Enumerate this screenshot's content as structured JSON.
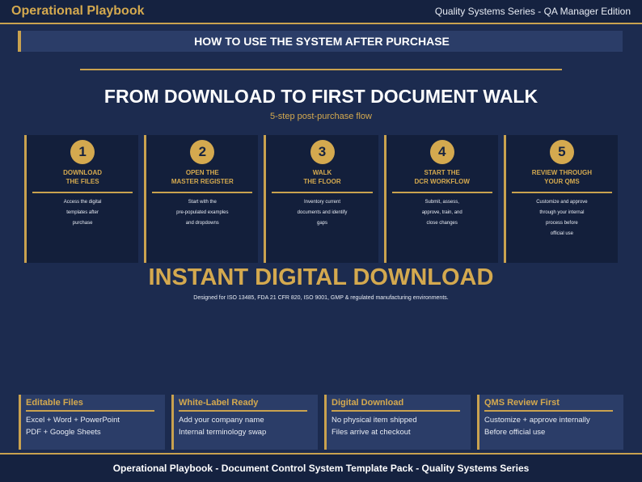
{
  "header": {
    "brand": "Operational Playbook",
    "edition": "Quality Systems Series - QA Manager Edition"
  },
  "banner": {
    "text": "HOW TO USE THE SYSTEM AFTER PURCHASE"
  },
  "hero": {
    "title": "FROM DOWNLOAD TO FIRST DOCUMENT WALK",
    "subtitle": "5-step post-purchase flow"
  },
  "steps": [
    {
      "num": "1",
      "title": "DOWNLOAD\nTHE FILES",
      "desc": "Access the digital\ntemplates after\npurchase"
    },
    {
      "num": "2",
      "title": "OPEN THE\nMASTER REGISTER",
      "desc": "Start with the\npre-populated examples\nand dropdowns"
    },
    {
      "num": "3",
      "title": "WALK\nTHE FLOOR",
      "desc": "Inventory current\ndocuments and identify\ngaps"
    },
    {
      "num": "4",
      "title": "START THE\nDCR WORKFLOW",
      "desc": "Submit, assess,\napprove, train, and\nclose changes"
    },
    {
      "num": "5",
      "title": "REVIEW THROUGH\nYOUR QMS",
      "desc": "Customize and approve\nthrough your internal\nprocess before\nofficial use"
    }
  ],
  "download": {
    "title": "INSTANT DIGITAL DOWNLOAD",
    "note": "Designed for ISO 13485, FDA 21 CFR 820, ISO 9001, GMP & regulated manufacturing environments."
  },
  "features": [
    {
      "title": "Editable Files",
      "line1": "Excel + Word + PowerPoint",
      "line2": "PDF + Google Sheets"
    },
    {
      "title": "White-Label Ready",
      "line1": "Add your company name",
      "line2": "Internal terminology swap"
    },
    {
      "title": "Digital Download",
      "line1": "No physical item shipped",
      "line2": "Files arrive at checkout"
    },
    {
      "title": "QMS Review First",
      "line1": "Customize + approve internally",
      "line2": "Before official use"
    }
  ],
  "footer": {
    "text": "Operational Playbook  -  Document Control System Template Pack  -  Quality Systems Series"
  },
  "colors": {
    "navy": "#1c2b4f",
    "gold": "#c9a24f",
    "panel": "#2b3d68"
  }
}
